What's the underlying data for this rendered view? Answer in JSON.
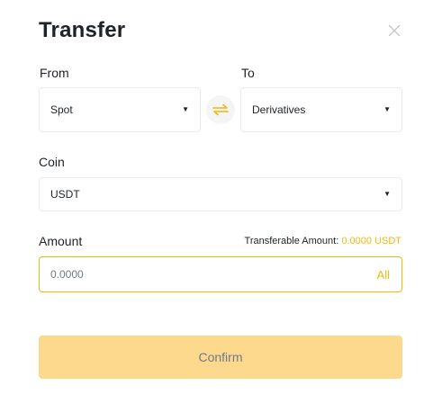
{
  "dialog": {
    "title": "Transfer"
  },
  "from": {
    "label": "From",
    "value": "Spot"
  },
  "to": {
    "label": "To",
    "value": "Derivatives"
  },
  "coin": {
    "label": "Coin",
    "value": "USDT"
  },
  "amount": {
    "label": "Amount",
    "transferable_label": "Transferable Amount:",
    "transferable_value": "0.0000 USDT",
    "placeholder": "0.0000",
    "all_label": "All"
  },
  "confirm": {
    "label": "Confirm"
  },
  "icons": {
    "close": "close-icon",
    "swap": "swap-arrows-icon",
    "caret": "caret-down-icon"
  },
  "colors": {
    "accent": "#f0b90b",
    "confirm_disabled_bg": "#fcd98c",
    "muted_text": "#707a8a"
  }
}
